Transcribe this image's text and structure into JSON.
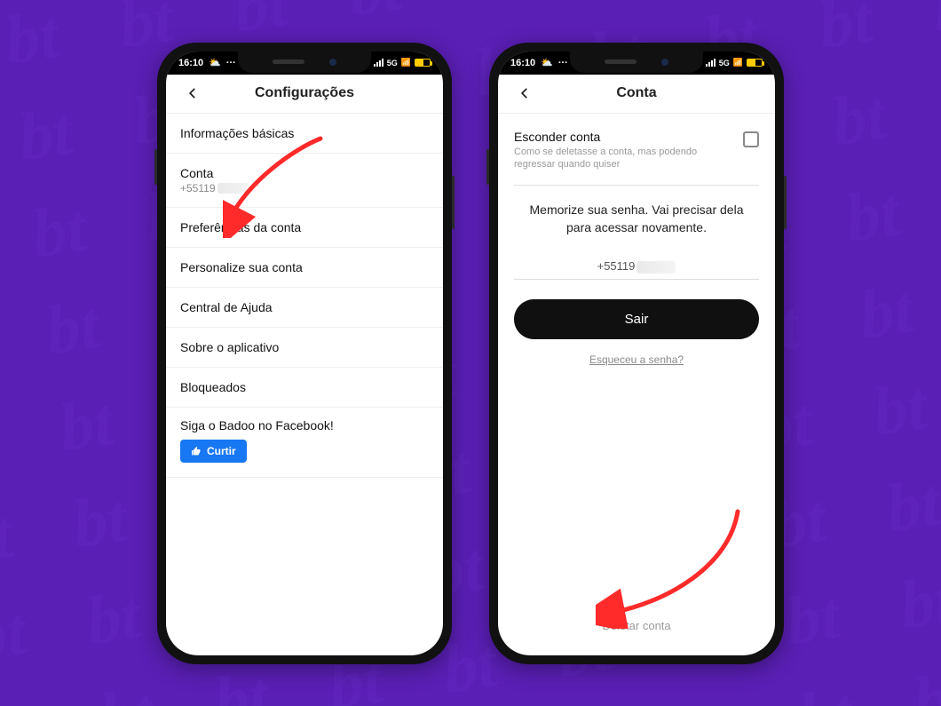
{
  "status": {
    "time": "16:10",
    "net1": "5G",
    "net2": "5G"
  },
  "screen1": {
    "title": "Configurações",
    "rows": {
      "basic": "Informações básicas",
      "account": "Conta",
      "account_sub": "+55119",
      "prefs": "Preferências da conta",
      "personalize": "Personalize sua conta",
      "help": "Central de Ajuda",
      "about": "Sobre o aplicativo",
      "blocked": "Bloqueados",
      "follow": "Siga o Badoo no Facebook!",
      "like": "Curtir"
    }
  },
  "screen2": {
    "title": "Conta",
    "hide_title": "Esconder conta",
    "hide_sub": "Como se deletasse a conta, mas podendo regressar quando quiser",
    "memorize": "Memorize sua senha. Vai precisar dela para acessar novamente.",
    "phone": "+55119",
    "logout": "Sair",
    "forgot": "Esqueceu a senha?",
    "delete": "Deletar conta"
  }
}
